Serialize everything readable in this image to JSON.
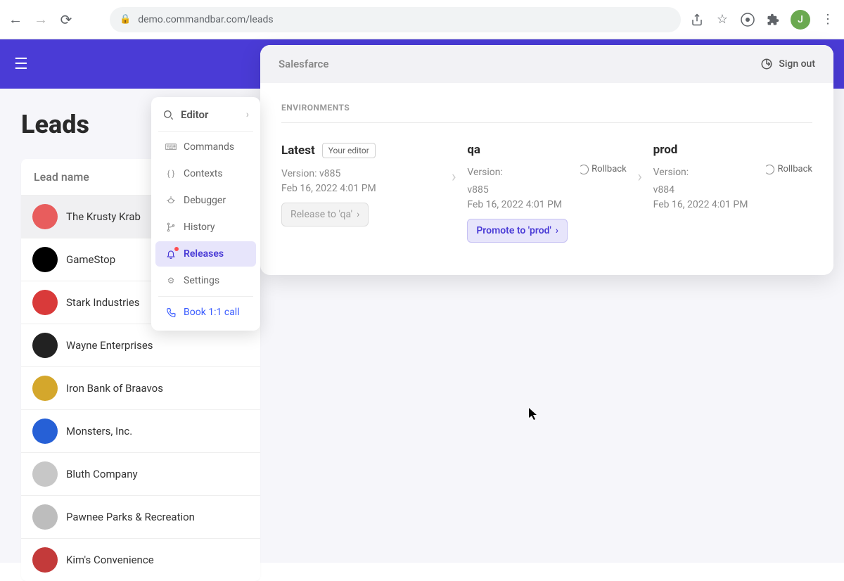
{
  "browser": {
    "url": "demo.commandbar.com/leads",
    "avatar_letter": "J"
  },
  "page_title": "Leads",
  "leads": {
    "header": "Lead name",
    "items": [
      {
        "name": "The Krusty Krab",
        "color": "#e85d5d"
      },
      {
        "name": "GameStop",
        "color": "#000000"
      },
      {
        "name": "Stark Industries",
        "color": "#d93a3a"
      },
      {
        "name": "Wayne Enterprises",
        "color": "#222222"
      },
      {
        "name": "Iron Bank of Braavos",
        "color": "#d4a72c"
      },
      {
        "name": "Monsters, Inc.",
        "color": "#2660d6"
      },
      {
        "name": "Bluth Company",
        "color": "#c7c7c7"
      },
      {
        "name": "Pawnee Parks & Recreation",
        "color": "#bdbdbd"
      },
      {
        "name": "Kim's Convenience",
        "color": "#c33a3a"
      }
    ]
  },
  "palette": {
    "head": "Editor",
    "items": {
      "commands": "Commands",
      "contexts": "Contexts",
      "debugger": "Debugger",
      "history": "History",
      "releases": "Releases",
      "settings": "Settings",
      "book": "Book 1:1 call"
    }
  },
  "releases": {
    "brand": "Salesfarce",
    "signout": "Sign out",
    "section": "ENVIRONMENTS",
    "envs": {
      "latest": {
        "title": "Latest",
        "badge": "Your editor",
        "version_label": "Version: v885",
        "date": "Feb 16, 2022 4:01 PM",
        "action": "Release to 'qa'"
      },
      "qa": {
        "title": "qa",
        "version_label": "Version:",
        "version_value": "v885",
        "rollback": "Rollback",
        "date": "Feb 16, 2022 4:01 PM",
        "action": "Promote to 'prod'"
      },
      "prod": {
        "title": "prod",
        "version_label": "Version:",
        "version_value": "v884",
        "rollback": "Rollback",
        "date": "Feb 16, 2022 4:01 PM"
      }
    }
  }
}
